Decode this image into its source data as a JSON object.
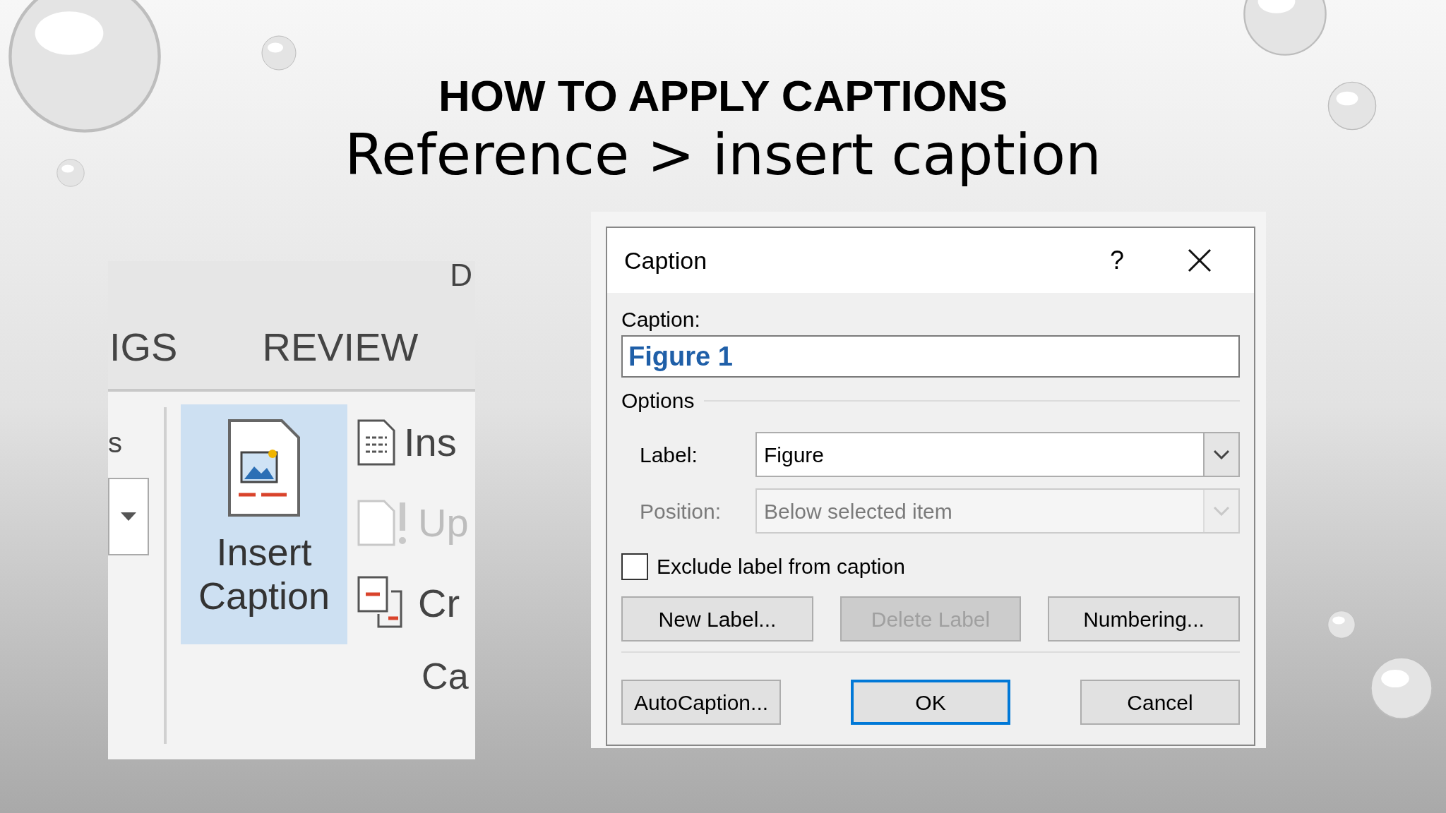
{
  "slide": {
    "title": "HOW TO APPLY CAPTIONS",
    "subtitle": "Reference > insert caption"
  },
  "ribbon": {
    "top_tab": "D",
    "tabs": [
      {
        "label": "IGS",
        "selected": false
      },
      {
        "label": "REVIEW",
        "selected": false
      }
    ],
    "left_label": "s",
    "insert_caption": {
      "lines": [
        "Insert",
        "Caption"
      ],
      "selected": true
    },
    "items": [
      {
        "kind": "insert",
        "label": "Ins",
        "disabled": false
      },
      {
        "kind": "update",
        "label": "Up",
        "disabled": true
      },
      {
        "kind": "cross",
        "label": "Cr",
        "disabled": false
      }
    ],
    "group_label": "Ca"
  },
  "dialog": {
    "title": "Caption",
    "help": "?",
    "caption_label": "Caption:",
    "caption_value": "Figure 1",
    "options_label": "Options",
    "fields": [
      {
        "label": "Label:",
        "value": "Figure",
        "disabled": false
      },
      {
        "label": "Position:",
        "value": "Below selected item",
        "disabled": true
      }
    ],
    "checkbox": {
      "label": "Exclude label from caption",
      "checked": false
    },
    "buttons": [
      {
        "label": "New Label...",
        "disabled": false,
        "default": false
      },
      {
        "label": "Delete Label",
        "disabled": true,
        "default": false
      },
      {
        "label": "Numbering...",
        "disabled": false,
        "default": false
      }
    ],
    "bottom_buttons": [
      {
        "label": "AutoCaption...",
        "disabled": false,
        "default": false
      },
      {
        "label": "OK",
        "disabled": false,
        "default": true
      },
      {
        "label": "Cancel",
        "disabled": false,
        "default": false
      }
    ]
  }
}
